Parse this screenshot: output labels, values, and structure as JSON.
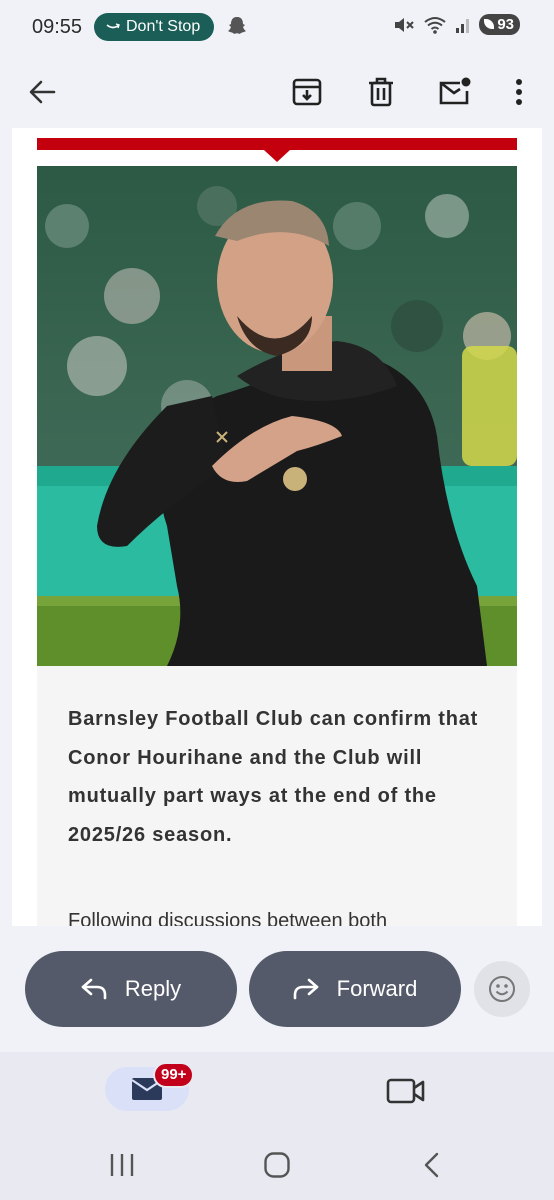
{
  "status_bar": {
    "time": "09:55",
    "pill_label": "Don't Stop",
    "battery": "93",
    "icons": [
      "amazon-music-icon",
      "snapchat-ghost-icon",
      "mute-icon",
      "wifi-icon",
      "signal-icon",
      "battery-icon"
    ]
  },
  "toolbar": {
    "icons": [
      "back-arrow-icon",
      "archive-icon",
      "delete-icon",
      "mark-unread-icon",
      "more-options-icon"
    ]
  },
  "email": {
    "headline": "Barnsley Football Club can confirm that Conor Hourihane and the Club will mutually part ways at the end of the 2025/26 season.",
    "body_start": "Following discussions between both",
    "accent_color": "#c4000e"
  },
  "actions": {
    "reply_label": "Reply",
    "forward_label": "Forward",
    "button_color": "#545a6a"
  },
  "bottom_nav": {
    "mail_badge": "99+",
    "tabs": [
      "mail-icon",
      "video-camera-icon"
    ]
  },
  "system_nav": [
    "recents-icon",
    "home-icon",
    "back-icon"
  ]
}
